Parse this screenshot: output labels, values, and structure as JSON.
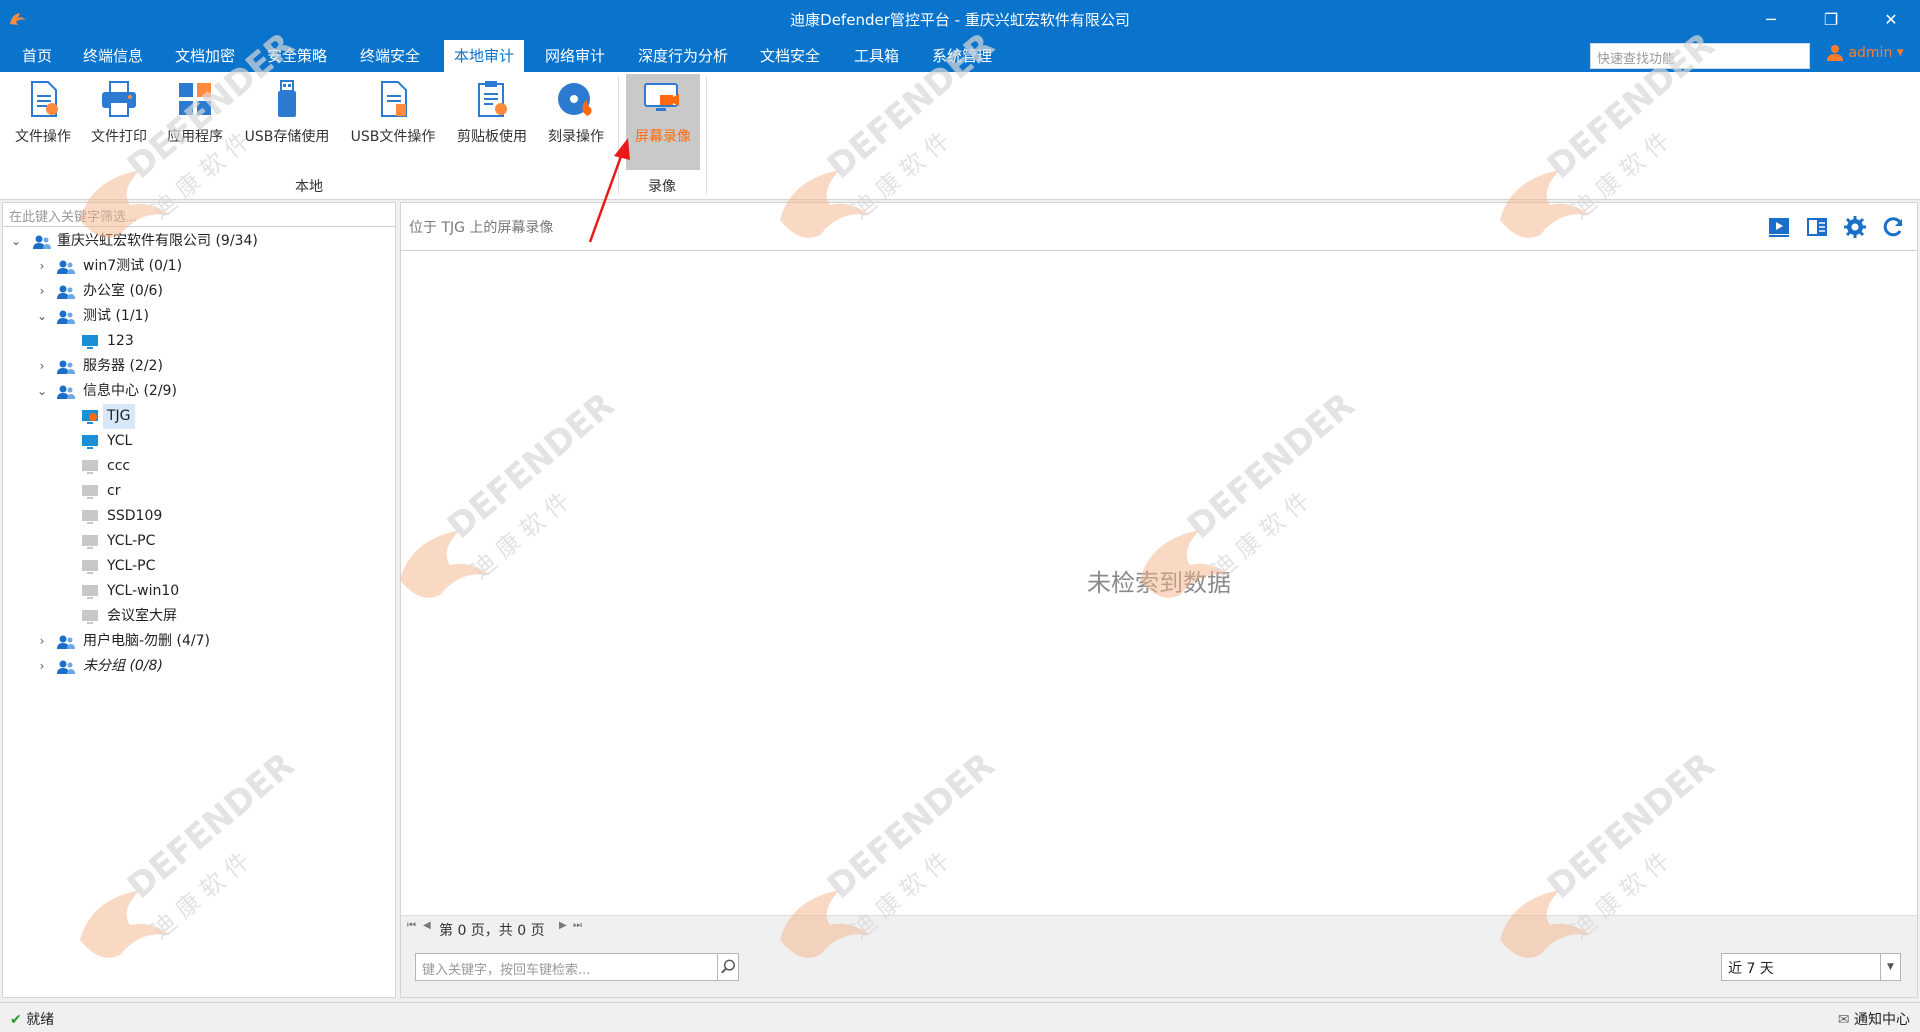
{
  "window": {
    "title": "迪康Defender管控平台 - 重庆兴虹宏软件有限公司"
  },
  "menu": {
    "items": [
      "首页",
      "终端信息",
      "文档加密",
      "安全策略",
      "终端安全",
      "本地审计",
      "网络审计",
      "深度行为分析",
      "文档安全",
      "工具箱",
      "系统管理"
    ],
    "active": "本地审计",
    "quick_search_placeholder": "快速查找功能",
    "user": "admin"
  },
  "ribbon": {
    "buttons": [
      {
        "label": "文件操作",
        "icon": "file-operation-icon"
      },
      {
        "label": "文件打印",
        "icon": "printer-icon"
      },
      {
        "label": "应用程序",
        "icon": "app-grid-icon"
      },
      {
        "label": "USB存储使用",
        "icon": "usb-drive-icon"
      },
      {
        "label": "USB文件操作",
        "icon": "usb-file-icon"
      },
      {
        "label": "剪贴板使用",
        "icon": "clipboard-icon"
      },
      {
        "label": "刻录操作",
        "icon": "disc-burn-icon"
      },
      {
        "label": "屏幕录像",
        "icon": "screen-record-icon",
        "selected": true
      }
    ],
    "groups": [
      "本地",
      "录像"
    ]
  },
  "left_panel": {
    "filter_placeholder": "在此键入关键字筛选...",
    "tree": [
      {
        "label": "重庆兴虹宏软件有限公司 (9/34)",
        "type": "group",
        "expanded": true
      },
      {
        "label": "win7测试 (0/1)",
        "type": "group",
        "expanded": false
      },
      {
        "label": "办公室 (0/6)",
        "type": "group",
        "expanded": false
      },
      {
        "label": "测试 (1/1)",
        "type": "group",
        "expanded": true
      },
      {
        "label": "123",
        "type": "computer",
        "online": true
      },
      {
        "label": "服务器 (2/2)",
        "type": "group",
        "expanded": false
      },
      {
        "label": "信息中心 (2/9)",
        "type": "group",
        "expanded": true
      },
      {
        "label": "TJG",
        "type": "computer",
        "online": true,
        "selected": true
      },
      {
        "label": "YCL",
        "type": "computer",
        "online": true
      },
      {
        "label": "ccc",
        "type": "computer",
        "online": false
      },
      {
        "label": "cr",
        "type": "computer",
        "online": false
      },
      {
        "label": "SSD109",
        "type": "computer",
        "online": false
      },
      {
        "label": "YCL-PC",
        "type": "computer",
        "online": false
      },
      {
        "label": "YCL-PC",
        "type": "computer",
        "online": false
      },
      {
        "label": "YCL-win10",
        "type": "computer",
        "online": false
      },
      {
        "label": "会议室大屏",
        "type": "computer",
        "online": false
      },
      {
        "label": "用户电脑-勿删 (4/7)",
        "type": "group",
        "expanded": false
      },
      {
        "label": "未分组 (0/8)",
        "type": "group",
        "expanded": false,
        "italic": true
      }
    ]
  },
  "right_panel": {
    "title": "位于 TJG 上的屏幕录像",
    "toolbar_icons": [
      "play-icon",
      "panel-icon",
      "settings-icon",
      "refresh-icon"
    ],
    "empty_message": "未检索到数据",
    "pager_text": "第 0 页，共 0 页",
    "keyword_placeholder": "键入关键字，按回车键检索...",
    "range_value": "近 7 天"
  },
  "status": {
    "left": "就绪",
    "right": "通知中心"
  },
  "watermark": {
    "text": "DEFENDER",
    "sub": "迪 康 软 件",
    "color": "#f4b48a"
  },
  "colors": {
    "accent": "#0a74cc",
    "highlight": "#ff6a10",
    "annotation": "#e8191a"
  }
}
